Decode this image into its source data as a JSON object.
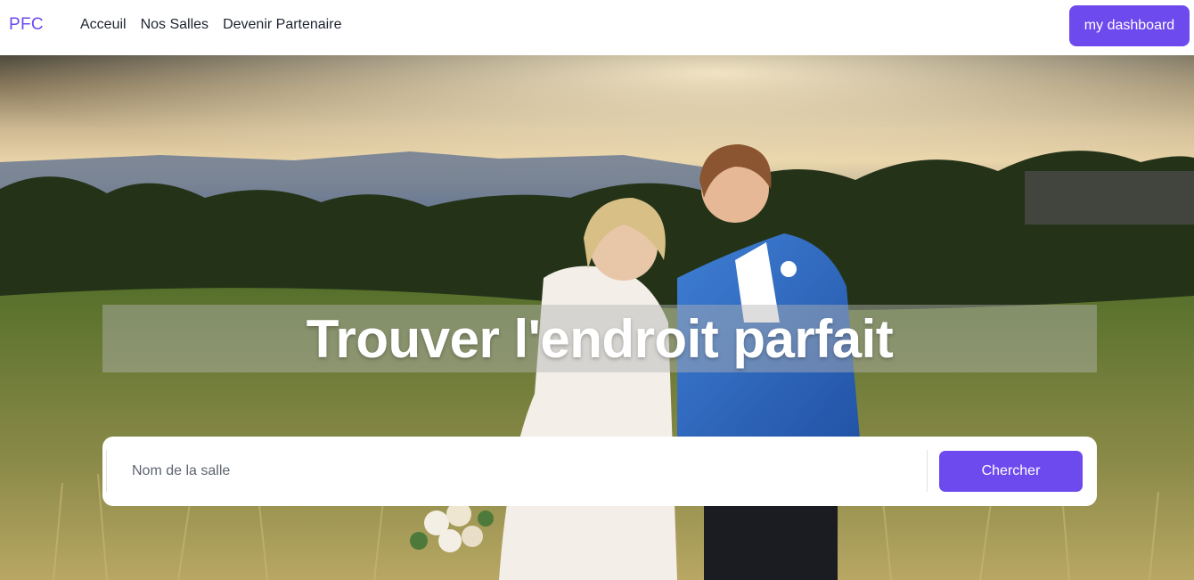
{
  "navbar": {
    "brand": "PFC",
    "links": [
      "Acceuil",
      "Nos Salles",
      "Devenir Partenaire"
    ],
    "dashboard_label": "my dashboard"
  },
  "hero": {
    "title": "Trouver l'endroit parfait",
    "image_description": "wedding-couple-in-meadow-at-sunset",
    "search": {
      "placeholder": "Nom de la salle",
      "value": "",
      "button_label": "Chercher"
    }
  },
  "colors": {
    "accent": "#6d4aee",
    "nav_text": "#1f2430",
    "white": "#ffffff"
  }
}
